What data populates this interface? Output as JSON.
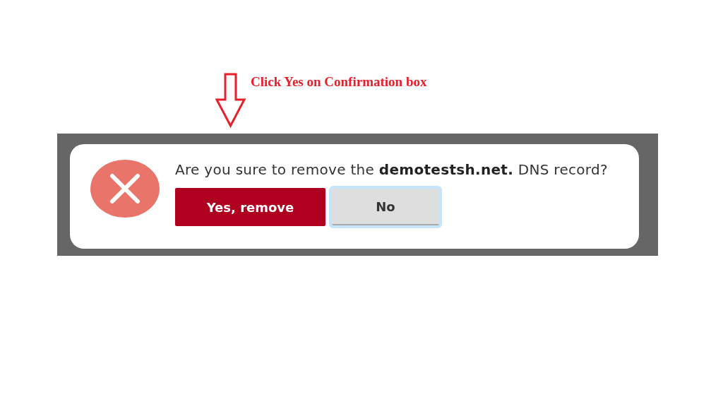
{
  "annotation": {
    "caption": "Click Yes on Confirmation box"
  },
  "dialog": {
    "message": "Are you sure to remove the **demotestsh.net.** DNS record?",
    "buttons": [
      {
        "label": "Yes, remove",
        "kind": "primary",
        "focused": false
      },
      {
        "label": "No",
        "kind": "secondary",
        "focused": true
      }
    ]
  }
}
